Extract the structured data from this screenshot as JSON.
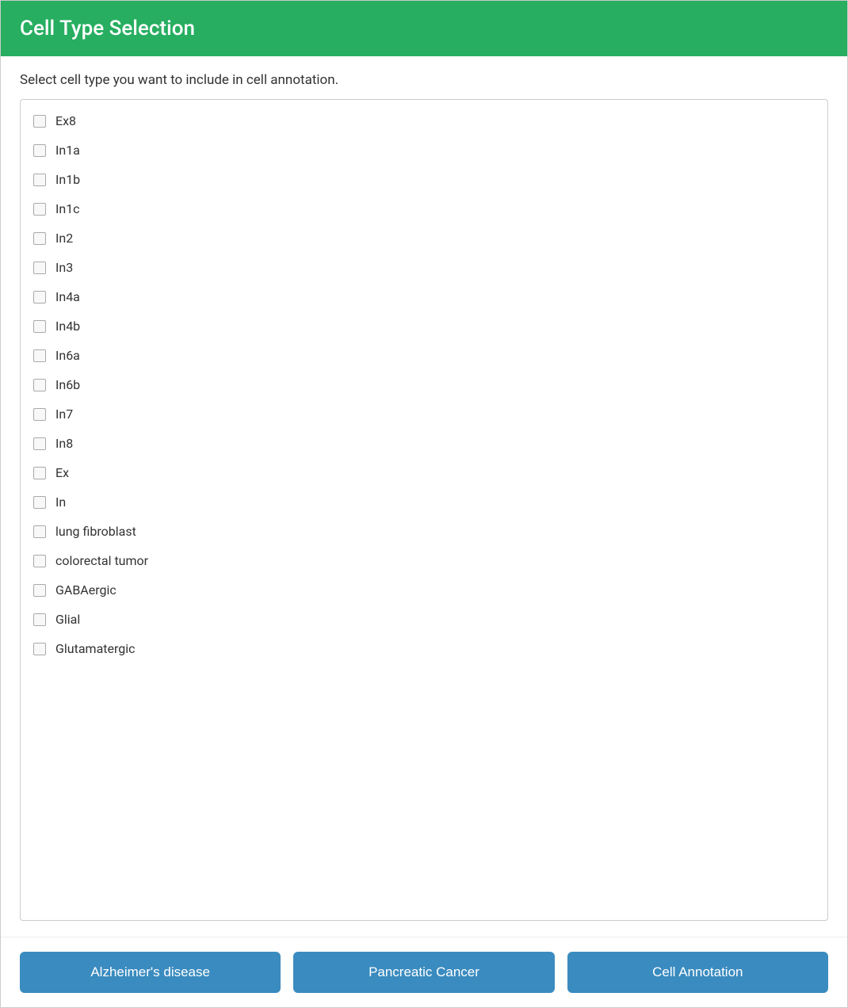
{
  "header": {
    "title": "Cell Type Selection"
  },
  "instruction": "Select cell type you want to include in cell annotation.",
  "cell_types": [
    {
      "id": "ex8",
      "label": "Ex8",
      "checked": false
    },
    {
      "id": "in1a",
      "label": "In1a",
      "checked": false
    },
    {
      "id": "in1b",
      "label": "In1b",
      "checked": false
    },
    {
      "id": "in1c",
      "label": "In1c",
      "checked": false
    },
    {
      "id": "in2",
      "label": "In2",
      "checked": false
    },
    {
      "id": "in3",
      "label": "In3",
      "checked": false
    },
    {
      "id": "in4a",
      "label": "In4a",
      "checked": false
    },
    {
      "id": "in4b",
      "label": "In4b",
      "checked": false
    },
    {
      "id": "in6a",
      "label": "In6a",
      "checked": false
    },
    {
      "id": "in6b",
      "label": "In6b",
      "checked": false
    },
    {
      "id": "in7",
      "label": "In7",
      "checked": false
    },
    {
      "id": "in8",
      "label": "In8",
      "checked": false
    },
    {
      "id": "ex",
      "label": "Ex",
      "checked": false
    },
    {
      "id": "in",
      "label": "In",
      "checked": false
    },
    {
      "id": "lung-fibroblast",
      "label": "lung fibroblast",
      "checked": false
    },
    {
      "id": "colorectal-tumor",
      "label": "colorectal tumor",
      "checked": false
    },
    {
      "id": "gabaergic",
      "label": "GABAergic",
      "checked": false
    },
    {
      "id": "glial",
      "label": "Glial",
      "checked": false
    },
    {
      "id": "glutamatergic",
      "label": "Glutamatergic",
      "checked": false
    }
  ],
  "footer": {
    "buttons": [
      {
        "id": "alzheimers",
        "label": "Alzheimer's disease"
      },
      {
        "id": "pancreatic",
        "label": "Pancreatic Cancer"
      },
      {
        "id": "annotation",
        "label": "Cell Annotation"
      }
    ]
  }
}
